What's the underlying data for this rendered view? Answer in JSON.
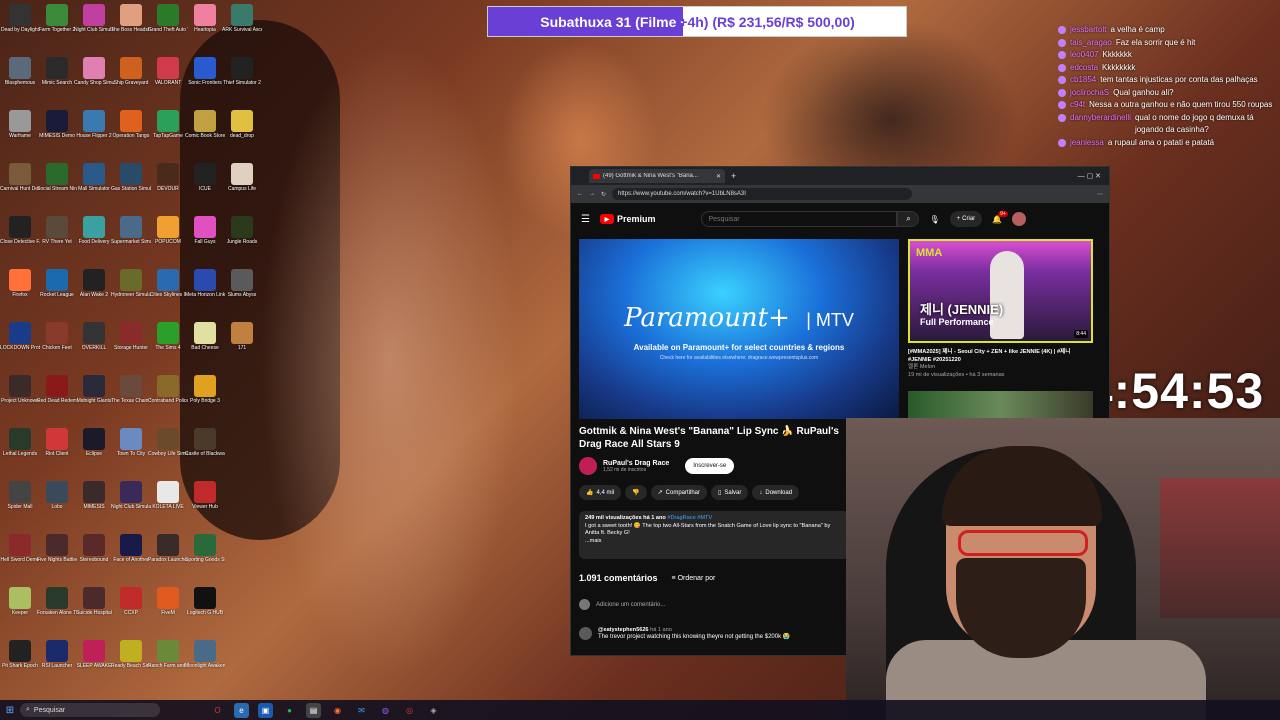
{
  "donation_goal": {
    "text": "Subathuxa 31 (Filme +4h) (R$ 231,56/R$ 500,00)",
    "raised": 231.56,
    "goal": 500.0,
    "fill_color": "#6a3fd6"
  },
  "desktop_icons": [
    {
      "label": "Dead by Daylight",
      "color": "#333"
    },
    {
      "label": "Blasphemous",
      "color": "#5a6a7a"
    },
    {
      "label": "Warframe",
      "color": "#999"
    },
    {
      "label": "Carnival Hunt Demo",
      "color": "#7a5a3a"
    },
    {
      "label": "Close Detective F...",
      "color": "#222"
    },
    {
      "label": "Firefox",
      "color": "#ff7139"
    },
    {
      "label": "LOCKDOWN Protocol",
      "color": "#1a3a8a"
    },
    {
      "label": "Project Unknown",
      "color": "#3a2a2a"
    },
    {
      "label": "Lethal Legends",
      "color": "#2a3a2a"
    },
    {
      "label": "Spider Mall",
      "color": "#444"
    },
    {
      "label": "Hell Sword Demo",
      "color": "#8a2a2a"
    },
    {
      "label": "Keeper",
      "color": "#aac060"
    },
    {
      "label": "Pit Shark Epoch",
      "color": "#222"
    },
    {
      "label": "Farm Together 2",
      "color": "#3a8a3a"
    },
    {
      "label": "Mimic Search",
      "color": "#2a2a2a"
    },
    {
      "label": "MIMESIS Demo",
      "color": "#1a1a3a"
    },
    {
      "label": "Social Stream Ninja",
      "color": "#2a6a2a"
    },
    {
      "label": "RV There Yet",
      "color": "#5a4a3a"
    },
    {
      "label": "Rocket League",
      "color": "#1a6ab0"
    },
    {
      "label": "Chicken Feet",
      "color": "#8a3a2a"
    },
    {
      "label": "Red Dead Redemption",
      "color": "#8a1a1a"
    },
    {
      "label": "Riot Client",
      "color": "#d13639"
    },
    {
      "label": "Lobo",
      "color": "#3a4a5a"
    },
    {
      "label": "Five Nights Battlecharge",
      "color": "#4a2a2a"
    },
    {
      "label": "Forsaken Alone The Ra...",
      "color": "#2a3a2a"
    },
    {
      "label": "RSI Launcher",
      "color": "#1a2a6a"
    },
    {
      "label": "Night Club Simulator",
      "color": "#c040a0"
    },
    {
      "label": "Candy Shop Simulator",
      "color": "#e080b0"
    },
    {
      "label": "House Flipper 2",
      "color": "#3a7ab0"
    },
    {
      "label": "Mall Simulator",
      "color": "#2a5a8a"
    },
    {
      "label": "Food Delivery",
      "color": "#3aa0a0"
    },
    {
      "label": "Alan Wake 2",
      "color": "#222"
    },
    {
      "label": "OVERKILL",
      "color": "#333"
    },
    {
      "label": "Midnight Giants",
      "color": "#2a2a3a"
    },
    {
      "label": "Eclipse",
      "color": "#1a1a2a"
    },
    {
      "label": "MIMESIS",
      "color": "#3a2a2a"
    },
    {
      "label": "Stereobound",
      "color": "#5a2a2a"
    },
    {
      "label": "Suicide Hospital",
      "color": "#4a2a2a"
    },
    {
      "label": "SLEEP AWAKE",
      "color": "#c0205a"
    },
    {
      "label": "The Boss Headshop",
      "color": "#e0a080"
    },
    {
      "label": "Ship Graveyard",
      "color": "#d06020"
    },
    {
      "label": "Operation Tango",
      "color": "#e06020"
    },
    {
      "label": "Gas Station Simulator",
      "color": "#2a4a6a"
    },
    {
      "label": "Supermarket Simulator",
      "color": "#4a6a8a"
    },
    {
      "label": "Hydroneer Simulator",
      "color": "#6a6a2a"
    },
    {
      "label": "Storage Hunter",
      "color": "#8a2a2a"
    },
    {
      "label": "The Texas Chain Sa...",
      "color": "#6a4a3a"
    },
    {
      "label": "Town To City",
      "color": "#6a8ac0"
    },
    {
      "label": "Night Club Simulator",
      "color": "#3a2a5a"
    },
    {
      "label": "Face of Another",
      "color": "#1a1a4a"
    },
    {
      "label": "CCXP",
      "color": "#c02a2a"
    },
    {
      "label": "Ready Beach Simulator",
      "color": "#c0b020"
    },
    {
      "label": "Grand Theft Auto V",
      "color": "#2a7a2a"
    },
    {
      "label": "VALORANT",
      "color": "#d13a4a"
    },
    {
      "label": "TapTapGame",
      "color": "#2aa05a"
    },
    {
      "label": "DEVOUR",
      "color": "#4a2a1a"
    },
    {
      "label": "POPUCOM",
      "color": "#f0a030"
    },
    {
      "label": "Cities Skylines II",
      "color": "#2a6ab0"
    },
    {
      "label": "The Sims 4",
      "color": "#2aa02a"
    },
    {
      "label": "Contraband Police",
      "color": "#8a6a2a"
    },
    {
      "label": "Cowboy Life Simulator",
      "color": "#6a4a2a"
    },
    {
      "label": "KOLETA LIVE",
      "color": "#e8e8e8"
    },
    {
      "label": "Paradox Launcher v2",
      "color": "#3a2a2a"
    },
    {
      "label": "FiveM",
      "color": "#e05a20"
    },
    {
      "label": "Ranch Farm and Store",
      "color": "#6a8a3a"
    },
    {
      "label": "Heartopia",
      "color": "#f080a0"
    },
    {
      "label": "Sonic Frontiers",
      "color": "#2a5ad0"
    },
    {
      "label": "Comic Book Store Sim",
      "color": "#c0a040"
    },
    {
      "label": "ICUE",
      "color": "#222"
    },
    {
      "label": "Fall Guys",
      "color": "#e050c0"
    },
    {
      "label": "Meta Horizon Link",
      "color": "#2a4ab0"
    },
    {
      "label": "Bad Cheese",
      "color": "#e0e0a0"
    },
    {
      "label": "Poly Bridge 3",
      "color": "#e0a020"
    },
    {
      "label": "Castle of Blackwater",
      "color": "#4a3a2a"
    },
    {
      "label": "Viewer Hub",
      "color": "#c02a2a"
    },
    {
      "label": "Sporting Goods Shop",
      "color": "#2a6a3a"
    },
    {
      "label": "Logitech G HUB",
      "color": "#111"
    },
    {
      "label": "Moonlight Awaken",
      "color": "#4a6a8a"
    },
    {
      "label": "ARK Survival Ascended",
      "color": "#3a7a6a"
    },
    {
      "label": "Thief Simulator 2",
      "color": "#222"
    },
    {
      "label": "dead_drop",
      "color": "#e0c040"
    },
    {
      "label": "Campus Life",
      "color": "#e0d0c0"
    },
    {
      "label": "Jungle Roads",
      "color": "#2a3a1a"
    },
    {
      "label": "Slums Abyss",
      "color": "#5a5a5a"
    },
    {
      "label": "171",
      "color": "#c08040"
    }
  ],
  "chat": [
    {
      "user": "jessbartolt",
      "text": "a velha é camp"
    },
    {
      "user": "tais_aragao",
      "text": "Faz ela sorrir que é hit"
    },
    {
      "user": "leo0407",
      "text": "Kkkkkkk"
    },
    {
      "user": "edcosta",
      "text": "Kkkkkkkk"
    },
    {
      "user": "cb1854",
      "text": "tem tantas injusticas por conta das palhaças"
    },
    {
      "user": "jociirochaS",
      "text": "Qual ganhou ali?"
    },
    {
      "user": "c94t",
      "text": "Nessa a outra ganhou e não quem tirou 550 roupas"
    },
    {
      "user": "dannyberardinelli",
      "text": "qual o nome do jogo q demuxa tá jogando da casinha?"
    },
    {
      "user": "jeanlessa",
      "text": "a rupaul ama o patati e patatá"
    }
  ],
  "timer": "54:54:53",
  "browser": {
    "tab_title": "(49) Gottmik & Nina West's \"Bana...",
    "url": "https://www.youtube.com/watch?v=1UbLN8sA3I"
  },
  "youtube": {
    "logo": "Premium",
    "search_placeholder": "Pesquisar",
    "create_label": "Criar",
    "notifications": "9+",
    "player": {
      "brand": "Paramount+",
      "available": "Available on Paramount+ for select countries & regions",
      "check": "Check here for availabilities elsewhere: dragrace.wowpresentsplus.com"
    },
    "video_title": "Gottmik & Nina West's \"Banana\" Lip Sync 🍌 RuPaul's Drag Race All Stars 9",
    "channel_name": "RuPaul's Drag Race",
    "channel_subs": "1,52 mi de inscritos",
    "subscribe_label": "Inscrever-se",
    "likes": "4,4 mil",
    "share_label": "Compartilhar",
    "save_label": "Salvar",
    "download_label": "Download",
    "description_stats": "249 mil visualizações  há 1 ano",
    "description_tags": "#DragRace #MTV",
    "description_text": "I got a sweet tooth! 😋 The top two All-Stars from the Snatch Game of Love lip sync to \"Banana\" by Anitta ft. Becky G!",
    "description_more": "...mais",
    "comment_count": "1.091 comentários",
    "sort_label": "Ordenar por",
    "add_comment_placeholder": "Adicione um comentário...",
    "comment": {
      "author": "@eatystephen5626",
      "time": "há 1 ano",
      "text": "The trevor project watching this knowing theyre not getting the $200k 😭"
    },
    "sidebar_video": {
      "title": "[#MMA2025] 제니 - Seoul City + ZEN + like JENNIE (4K) | #제니 #JENNIE #20251220",
      "channel": "멜론 Melon",
      "meta": "19 mi de visualizações • há 3 semanas",
      "thumb_brand": "MMA",
      "thumb_name": "제니 (JENNIE)",
      "thumb_sub": "Full Performance",
      "duration": "8:44"
    }
  },
  "taskbar": {
    "search_placeholder": "Pesquisar"
  }
}
